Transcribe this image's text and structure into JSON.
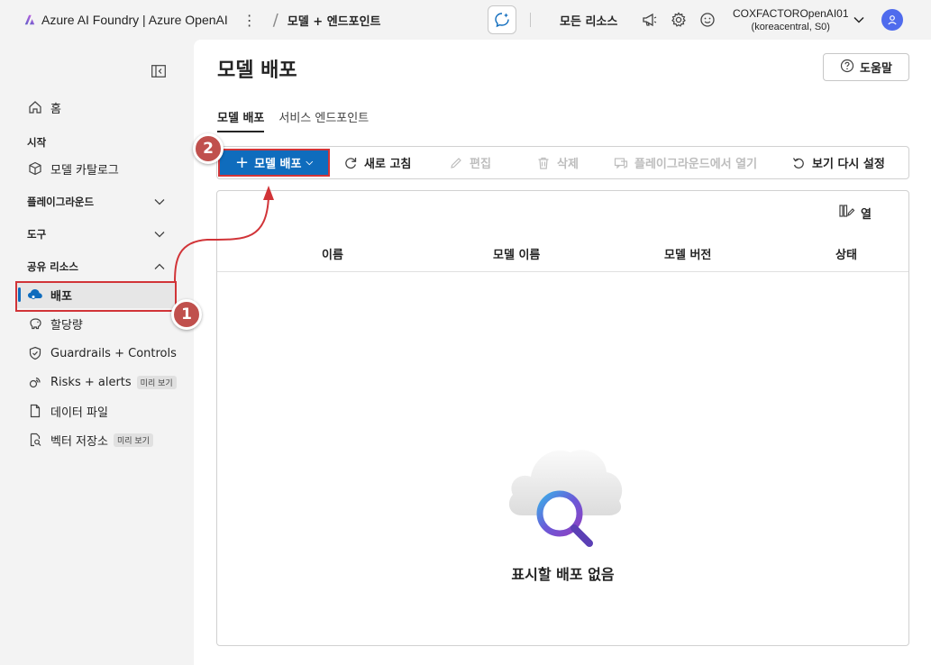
{
  "topbar": {
    "brand": "Azure AI Foundry | Azure OpenAI",
    "breadcrumb": "모델 + 엔드포인트",
    "all_resources": "모든 리소스",
    "account_name": "COXFACTOROpenAI01",
    "account_region": "(koreacentral, S0)",
    "icons": [
      "megaphone-icon",
      "gear-icon",
      "smiley-icon",
      "person-icon",
      "copilot-icon"
    ]
  },
  "sidebar": {
    "home": "홈",
    "section_start": "시작",
    "model_catalog": "모델 카탈로그",
    "section_playground": "플레이그라운드",
    "section_tools": "도구",
    "section_shared": "공유 리소스",
    "deployments": "배포",
    "quota": "할당량",
    "guardrails": "Guardrails + Controls",
    "risks": "Risks + alerts",
    "risks_badge": "미리 보기",
    "data_files": "데이터 파일",
    "vector_stores": "벡터 저장소",
    "vector_badge": "미리 보기"
  },
  "main": {
    "title": "모델 배포",
    "help": "도움말",
    "tabs": [
      "모델 배포",
      "서비스 엔드포인트"
    ],
    "toolbar": {
      "deploy": "모델 배포",
      "refresh": "새로 고침",
      "edit": "편집",
      "delete": "삭제",
      "open_playground": "플레이그라운드에서 열기",
      "reset_view": "보기 다시 설정"
    },
    "columns_btn": "열",
    "columns": [
      "이름",
      "모델 이름",
      "모델 버전",
      "상태"
    ],
    "empty": "표시할 배포 없음"
  },
  "annotations": {
    "step1": "1",
    "step2": "2",
    "highlight_color": "#d13438",
    "badge_color": "#c0504d"
  },
  "colors": {
    "accent": "#0f6cbd",
    "avatar": "#4f6bed"
  }
}
